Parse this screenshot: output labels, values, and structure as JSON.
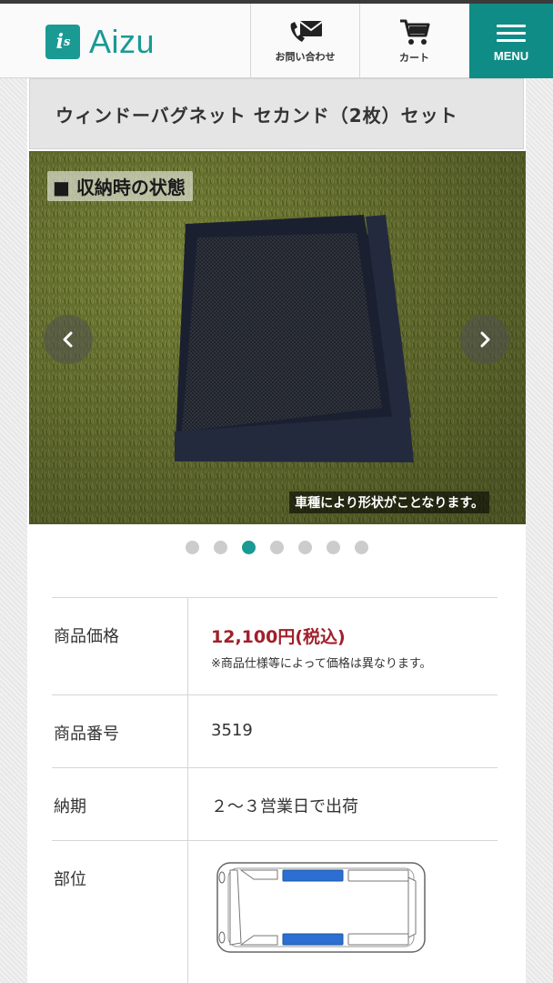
{
  "header": {
    "logo_mark": "i",
    "logo_mark_sub": "s",
    "logo_text": "Aizu",
    "contact_label": "お問い合わせ",
    "cart_label": "カート",
    "menu_label": "MENU"
  },
  "product": {
    "title": "ウィンドーバグネット セカンド（2枚）セット"
  },
  "slider": {
    "overlay_label": "■ 収納時の状態",
    "caption": "車種により形状がことなります。",
    "slide_count": 7,
    "active_index": 2
  },
  "spec": {
    "price_key": "商品価格",
    "price_value": "12,100円(税込)",
    "price_note": "※商品仕様等によって価格は異なります。",
    "number_key": "商品番号",
    "number_value": "3519",
    "delivery_key": "納期",
    "delivery_value": "２～３営業日で出荷",
    "position_key": "部位"
  },
  "colors": {
    "brand": "#1a9a93",
    "price": "#a0202a",
    "highlight_window": "#2a6fd1"
  },
  "icons": {
    "contact": "phone-mail-icon",
    "cart": "cart-icon",
    "menu": "hamburger-icon",
    "prev": "chevron-left-icon",
    "next": "chevron-right-icon"
  }
}
